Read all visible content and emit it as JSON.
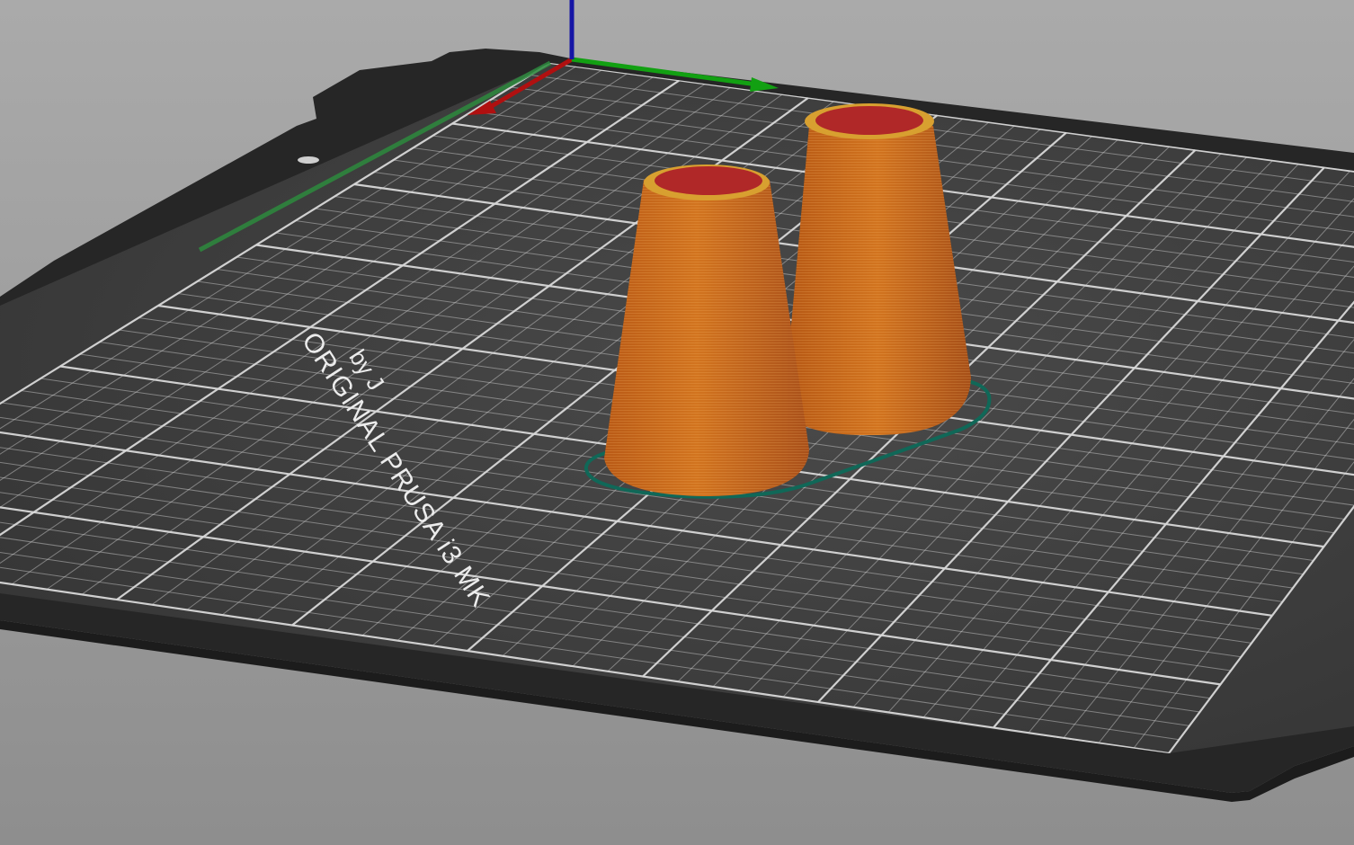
{
  "viewport": {
    "name": "3D preview",
    "background_top": "#aaaaaa",
    "background_bottom": "#8e8e8e"
  },
  "bed": {
    "label_line1": "ORIGINAL PRUSA i3 MK",
    "label_line2": "by J",
    "surface_color": "#3d3d3d",
    "frame_color": "#262626",
    "grid_color": "#d8d8d8"
  },
  "axes": {
    "x_color": "#b01010",
    "y_color": "#12a012",
    "z_color": "#1515a5"
  },
  "objects": [
    {
      "name": "cone-left",
      "color": "#c8641c",
      "top_fill": "#b02828"
    },
    {
      "name": "cone-right",
      "color": "#c8641c",
      "top_fill": "#b02828"
    }
  ],
  "skirt": {
    "color": "#106858"
  }
}
